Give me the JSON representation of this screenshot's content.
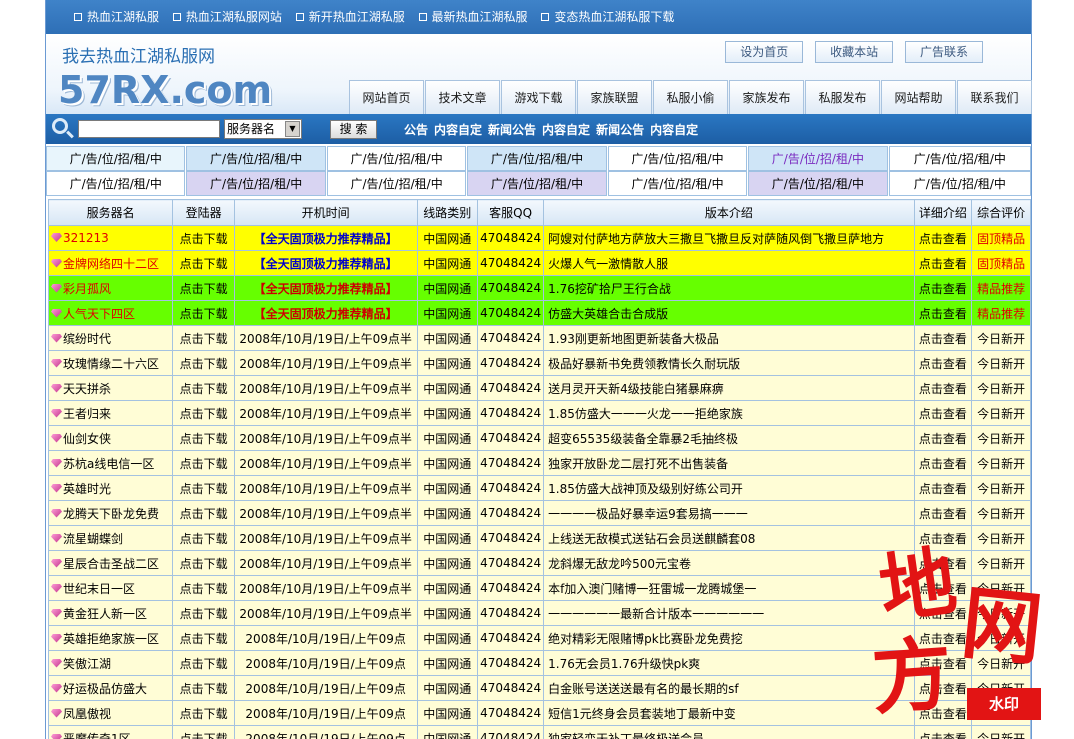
{
  "topbar": {
    "links": [
      "热血江湖私服",
      "热血江湖私服网站",
      "新开热血江湖私服",
      "最新热血江湖私服",
      "变态热血江湖私服下载"
    ]
  },
  "header": {
    "slogan": "我去热血江湖私服网",
    "logo": "57RX.com",
    "buttons": [
      "设为首页",
      "收藏本站",
      "广告联系"
    ],
    "nav": [
      "网站首页",
      "技术文章",
      "游戏下载",
      "家族联盟",
      "私服小偷",
      "家族发布",
      "私服发布",
      "网站帮助",
      "联系我们"
    ]
  },
  "search": {
    "value": "",
    "select": "服务器名",
    "button": "搜 索",
    "notices": [
      "公告",
      "内容自定",
      "新闻公告",
      "内容自定",
      "新闻公告",
      "内容自定"
    ]
  },
  "ads": {
    "rows": [
      [
        "广/告/位/招/租/中",
        "广/告/位/招/租/中",
        "广/告/位/招/租/中",
        "广/告/位/招/租/中",
        "广/告/位/招/租/中",
        "广/告/位/招/租/中",
        "广/告/位/招/租/中"
      ],
      [
        "广/告/位/招/租/中",
        "广/告/位/招/租/中",
        "广/告/位/招/租/中",
        "广/告/位/招/租/中",
        "广/告/位/招/租/中",
        "广/告/位/招/租/中",
        "广/告/位/招/租/中"
      ]
    ],
    "colors": {
      "row0": [
        "#e8f5fc",
        "#cfe5f7",
        "#ffffff",
        "#cfe5f7",
        "#ffffff",
        "#cfe5f7",
        "#ffffff"
      ],
      "row1": [
        "#ffffff",
        "#d8d4f2",
        "#ffffff",
        "#d8d4f2",
        "#ffffff",
        "#d8d4f2",
        "#ffffff"
      ],
      "highlight_text": "#7a2bc0"
    }
  },
  "table": {
    "headers": [
      "服务器名",
      "登陆器",
      "开机时间",
      "线路类别",
      "客服QQ",
      "版本介绍",
      "详细介绍",
      "综合评价"
    ],
    "rows": [
      {
        "style": "yellow",
        "name": "321213",
        "login": "点击下载",
        "time": "【全天固顶极力推荐精品】",
        "line": "中国网通",
        "qq": "47048424",
        "ver": "阿嫂对付萨地方萨放大三撒旦飞撒旦反对萨随风倒飞撒旦萨地方",
        "detail": "点击查看",
        "eval": "固顶精品"
      },
      {
        "style": "yellow",
        "name": "金牌网络四十二区",
        "login": "点击下载",
        "time": "【全天固顶极力推荐精品】",
        "line": "中国网通",
        "qq": "47048424",
        "ver": "火爆人气一激情散人服",
        "detail": "点击查看",
        "eval": "固顶精品"
      },
      {
        "style": "green",
        "name": "彩月孤风",
        "login": "点击下载",
        "time": "【全天固顶极力推荐精品】",
        "line": "中国网通",
        "qq": "47048424",
        "ver": "1.76挖矿拾尸王行合战",
        "detail": "点击查看",
        "eval": "精品推荐"
      },
      {
        "style": "green",
        "name": "人气天下四区",
        "login": "点击下载",
        "time": "【全天固顶极力推荐精品】",
        "line": "中国网通",
        "qq": "47048424",
        "ver": "仿盛大英雄合击合成版",
        "detail": "点击查看",
        "eval": "精品推荐"
      },
      {
        "style": "normal",
        "name": "缤纷时代",
        "login": "点击下载",
        "time": "2008年/10月/19日/上午09点半",
        "line": "中国网通",
        "qq": "47048424",
        "ver": "1.93刚更新地图更新装备大极品",
        "detail": "点击查看",
        "eval": "今日新开"
      },
      {
        "style": "normal",
        "name": "玫瑰情缘二十六区",
        "login": "点击下载",
        "time": "2008年/10月/19日/上午09点半",
        "line": "中国网通",
        "qq": "47048424",
        "ver": "极品好暴新书免费领教情长久耐玩版",
        "detail": "点击查看",
        "eval": "今日新开"
      },
      {
        "style": "normal",
        "name": "天天拼杀",
        "login": "点击下载",
        "time": "2008年/10月/19日/上午09点半",
        "line": "中国网通",
        "qq": "47048424",
        "ver": "送月灵开天新4级技能白猪暴麻痹",
        "detail": "点击查看",
        "eval": "今日新开"
      },
      {
        "style": "normal",
        "name": "王者归来",
        "login": "点击下载",
        "time": "2008年/10月/19日/上午09点半",
        "line": "中国网通",
        "qq": "47048424",
        "ver": "1.85仿盛大一一一火龙一一拒绝家族",
        "detail": "点击查看",
        "eval": "今日新开"
      },
      {
        "style": "normal",
        "name": "仙剑女侠",
        "login": "点击下载",
        "time": "2008年/10月/19日/上午09点半",
        "line": "中国网通",
        "qq": "47048424",
        "ver": "超变65535级装备全靠暴2毛抽终极",
        "detail": "点击查看",
        "eval": "今日新开"
      },
      {
        "style": "normal",
        "name": "苏杭a线电信一区",
        "login": "点击下载",
        "time": "2008年/10月/19日/上午09点半",
        "line": "中国网通",
        "qq": "47048424",
        "ver": "独家开放卧龙二层打死不出售装备",
        "detail": "点击查看",
        "eval": "今日新开"
      },
      {
        "style": "normal",
        "name": "英雄时光",
        "login": "点击下载",
        "time": "2008年/10月/19日/上午09点半",
        "line": "中国网通",
        "qq": "47048424",
        "ver": "1.85仿盛大战神顶及级别好练公司开",
        "detail": "点击查看",
        "eval": "今日新开"
      },
      {
        "style": "normal",
        "name": "龙腾天下卧龙免费",
        "login": "点击下载",
        "time": "2008年/10月/19日/上午09点半",
        "line": "中国网通",
        "qq": "47048424",
        "ver": "一一一一极品好暴幸运9套易搞一一一",
        "detail": "点击查看",
        "eval": "今日新开"
      },
      {
        "style": "normal",
        "name": "流星蝴蝶剑",
        "login": "点击下载",
        "time": "2008年/10月/19日/上午09点半",
        "line": "中国网通",
        "qq": "47048424",
        "ver": "上线送无敌模式送钻石会员送麒麟套08",
        "detail": "点击查看",
        "eval": "今日新开"
      },
      {
        "style": "normal",
        "name": "星辰合击圣战二区",
        "login": "点击下载",
        "time": "2008年/10月/19日/上午09点半",
        "line": "中国网通",
        "qq": "47048424",
        "ver": "龙斜爆无敌龙吟500元宝卷",
        "detail": "点击查看",
        "eval": "今日新开"
      },
      {
        "style": "normal",
        "name": "世纪末日一区",
        "login": "点击下载",
        "time": "2008年/10月/19日/上午09点半",
        "line": "中国网通",
        "qq": "47048424",
        "ver": "本f加入澳门赌博一狂雷城一龙腾城堡一",
        "detail": "点击查看",
        "eval": "今日新开"
      },
      {
        "style": "normal",
        "name": "黄金狂人新一区",
        "login": "点击下载",
        "time": "2008年/10月/19日/上午09点半",
        "line": "中国网通",
        "qq": "47048424",
        "ver": "一一一一一一最新合计版本一一一一一一",
        "detail": "点击查看",
        "eval": "今日新开"
      },
      {
        "style": "normal",
        "name": "英雄拒绝家族一区",
        "login": "点击下载",
        "time": "2008年/10月/19日/上午09点",
        "line": "中国网通",
        "qq": "47048424",
        "ver": "绝对精彩无限赌博pk比赛卧龙免费挖",
        "detail": "点击查看",
        "eval": "今日新开"
      },
      {
        "style": "normal",
        "name": "笑傲江湖",
        "login": "点击下载",
        "time": "2008年/10月/19日/上午09点",
        "line": "中国网通",
        "qq": "47048424",
        "ver": "1.76无会员1.76升级快pk爽",
        "detail": "点击查看",
        "eval": "今日新开"
      },
      {
        "style": "normal",
        "name": "好运极品仿盛大",
        "login": "点击下载",
        "time": "2008年/10月/19日/上午09点",
        "line": "中国网通",
        "qq": "47048424",
        "ver": "白金账号送送送最有名的最长期的sf",
        "detail": "点击查看",
        "eval": "今日新开"
      },
      {
        "style": "normal",
        "name": "凤凰傲视",
        "login": "点击下载",
        "time": "2008年/10月/19日/上午09点",
        "line": "中国网通",
        "qq": "47048424",
        "ver": "短信1元终身会员套装地丁最新中变",
        "detail": "点击查看",
        "eval": "今日新开"
      },
      {
        "style": "normal",
        "name": "恶魔传奇1区",
        "login": "点击下载",
        "time": "2008年/10月/19日/上午09点",
        "line": "中国网通",
        "qq": "47048424",
        "ver": "独家轻变天补丁最终极送会员",
        "detail": "点击查看",
        "eval": "今日新开"
      }
    ]
  },
  "watermark": {
    "chars": [
      "地",
      "网",
      "方"
    ],
    "stamp": "水印"
  },
  "colors": {
    "topbar": "#3279c0",
    "search_bar": "#2169b4",
    "row_yellow": "#ffff00",
    "row_green": "#66ff00",
    "row_normal": "#fffdd6",
    "recommend_text_red": "#e00000",
    "recommend_text_blue": "#0000cc",
    "watermark_red": "#e21414"
  }
}
